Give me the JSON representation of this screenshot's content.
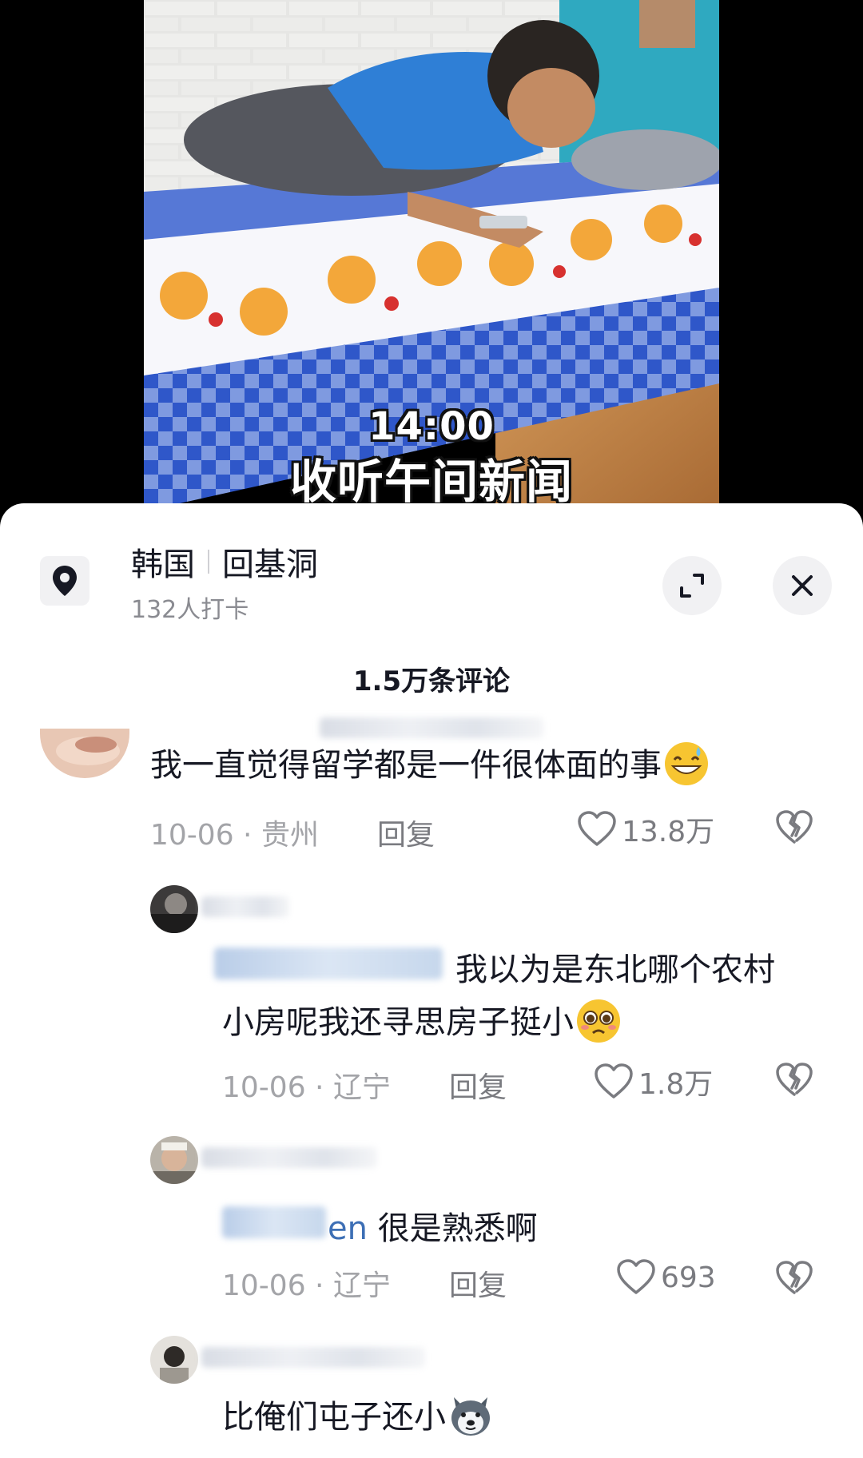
{
  "video": {
    "overlay_time": "14:00",
    "overlay_caption": "收听午间新闻"
  },
  "location": {
    "country": "韩国",
    "place": "回基洞",
    "checkins": "132人打卡",
    "icon": "location-pin-icon"
  },
  "buttons": {
    "expand_icon": "expand-icon",
    "close_icon": "close-icon"
  },
  "comments_header": {
    "count": "1.5万条评论"
  },
  "comments": [
    {
      "text": "我一直觉得留学都是一件很体面的事",
      "emoji": "grinning-sweat-emoji",
      "date": "10-06",
      "region": "贵州",
      "reply": "回复",
      "likes": "13.8万"
    },
    {
      "text": "我以为是东北哪个农村",
      "text_line2": "小房呢我还寻思房子挺小",
      "emoji": "pleading-emoji",
      "date": "10-06",
      "region": "辽宁",
      "reply": "回复",
      "likes": "1.8万"
    },
    {
      "mention_suffix": "en",
      "text": "很是熟悉啊",
      "date": "10-06",
      "region": "辽宁",
      "reply": "回复",
      "likes": "693"
    },
    {
      "text": "比俺们屯子还小",
      "emoji": "husky-dog-emoji"
    }
  ],
  "colors": {
    "text_primary": "#161823",
    "text_secondary": "#a3a4a8",
    "sheet_bg": "#ffffff",
    "button_bg": "#f1f1f3"
  }
}
